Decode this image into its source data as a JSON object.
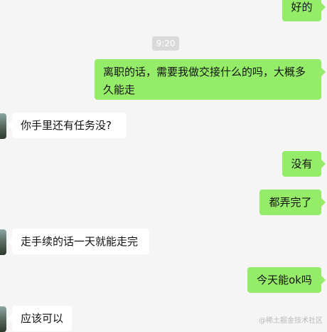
{
  "timestamp": "9:20",
  "messages": [
    {
      "side": "out",
      "text": "好的"
    },
    {
      "side": "out",
      "text": "离职的话，需要我做交接什么的吗，大概多\n久能走"
    },
    {
      "side": "in",
      "text": "你手里还有任务没?"
    },
    {
      "side": "out",
      "text": "没有"
    },
    {
      "side": "out",
      "text": "都弄完了"
    },
    {
      "side": "in",
      "text": "走手续的话一天就能走完"
    },
    {
      "side": "out",
      "text": "今天能ok吗"
    },
    {
      "side": "in",
      "text": "应该可以"
    }
  ],
  "watermark": "@稀土掘金技术社区",
  "colors": {
    "background": "#f5f5f5",
    "outgoing_bubble": "#95ec69",
    "incoming_bubble": "#ffffff",
    "timestamp_bg": "#dadada"
  }
}
